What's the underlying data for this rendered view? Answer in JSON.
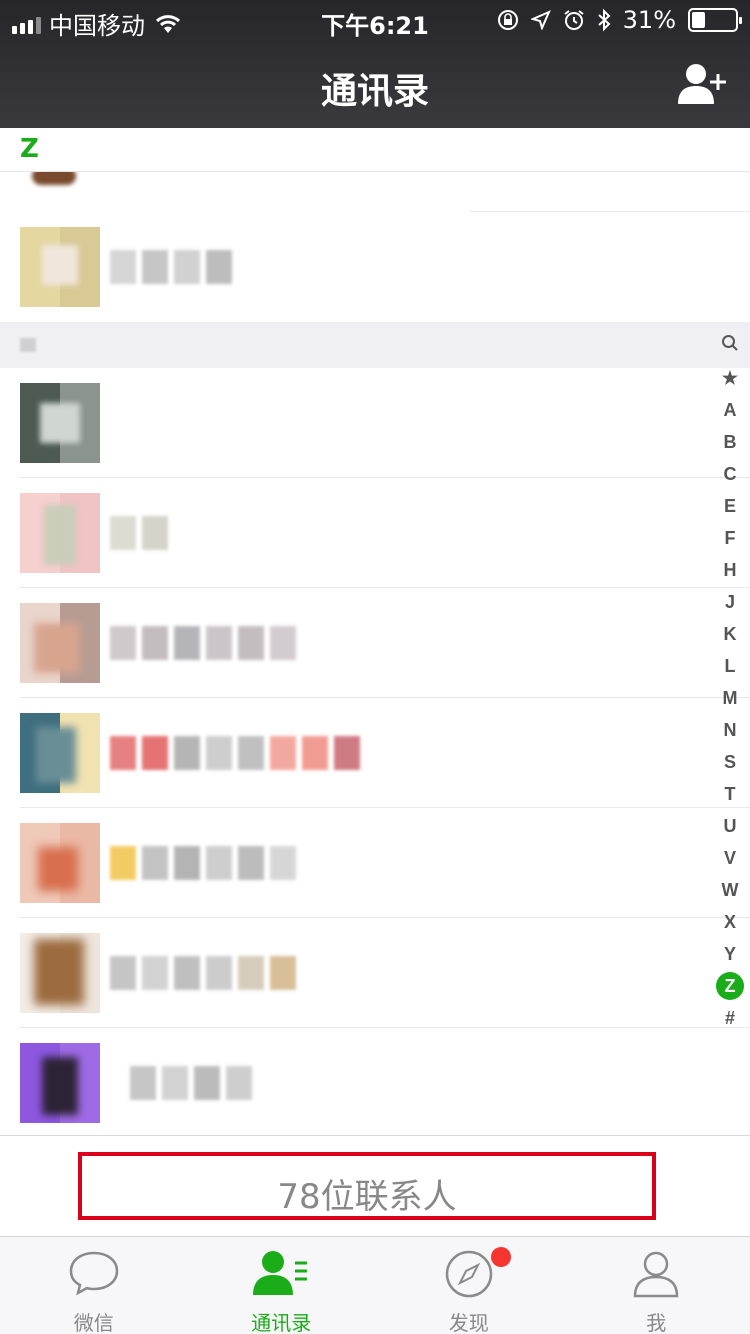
{
  "status_bar": {
    "carrier": "中国移动",
    "time": "下午6:21",
    "battery": "31%",
    "battery_level": 0.31
  },
  "header": {
    "title": "通讯录",
    "add_contact_icon": "add-contact-icon"
  },
  "section_z": {
    "letter": "Z"
  },
  "index_letters": [
    "🔍",
    "★",
    "A",
    "B",
    "C",
    "E",
    "F",
    "H",
    "J",
    "K",
    "L",
    "M",
    "N",
    "S",
    "T",
    "U",
    "V",
    "W",
    "X",
    "Y",
    "Z",
    "#"
  ],
  "index_active": "Z",
  "contacts_count": "78位联系人",
  "tabs": [
    {
      "label": "微信",
      "icon": "chat-icon"
    },
    {
      "label": "通讯录",
      "icon": "contacts-icon",
      "active": true
    },
    {
      "label": "发现",
      "icon": "compass-icon",
      "badge": true
    },
    {
      "label": "我",
      "icon": "person-icon"
    }
  ],
  "colors": {
    "accent": "#1aad19",
    "highlight_box": "#d9001b",
    "badge": "#f43530"
  }
}
